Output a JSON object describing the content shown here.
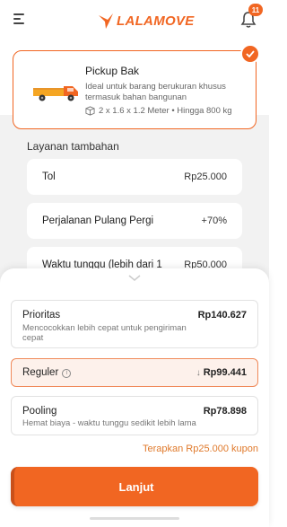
{
  "header": {
    "logo_text": "LALAMOVE",
    "notification_count": "11"
  },
  "vehicle": {
    "title": "Pickup Bak",
    "description": "Ideal untuk barang berukuran khusus termasuk bahan bangunan",
    "spec": "2 x 1.6 x 1.2 Meter • Hingga 800 kg"
  },
  "additional_services": {
    "title": "Layanan tambahan",
    "items": [
      {
        "label": "Tol",
        "value": "Rp25.000"
      },
      {
        "label": "Perjalanan Pulang Pergi",
        "value": "+70%"
      },
      {
        "label": "Waktu tunggu (lebih dari 1",
        "value": "Rp50.000"
      }
    ]
  },
  "delivery_options": [
    {
      "title": "Prioritas",
      "subtitle": "Mencocokkan lebih cepat untuk pengiriman cepat",
      "price": "Rp140.627",
      "selected": false
    },
    {
      "title": "Reguler",
      "subtitle": "",
      "price": "Rp99.441",
      "selected": true
    },
    {
      "title": "Pooling",
      "subtitle": "Hemat biaya - waktu tunggu sedikit lebih lama",
      "price": "Rp78.898",
      "selected": false
    }
  ],
  "coupon_text": "Terapkan Rp25.000 kupon",
  "next_button_label": "Lanjut",
  "colors": {
    "accent": "#f16622",
    "selected_bg": "#fdf1eb",
    "coupon": "#e07a2c"
  },
  "icons": [
    "menu-icon",
    "logo-bird-icon",
    "bell-icon",
    "check-icon",
    "truck-icon",
    "box-icon",
    "chevron-down-icon",
    "info-icon",
    "arrow-down-icon"
  ]
}
